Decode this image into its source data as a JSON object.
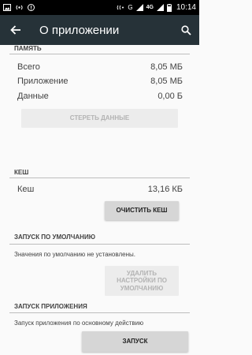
{
  "status_bar": {
    "time": "10:14",
    "network": "4G"
  },
  "app_bar": {
    "title": "О приложении"
  },
  "memory": {
    "header": "ПАМЯТЬ",
    "rows": [
      {
        "label": "Всего",
        "value": "8,05 МБ"
      },
      {
        "label": "Приложение",
        "value": "8,05 МБ"
      },
      {
        "label": "Данные",
        "value": "0,00 Б"
      }
    ],
    "clear_data_label": "СТЕРЕТЬ ДАННЫЕ"
  },
  "cache": {
    "header": "КЕШ",
    "label": "Кеш",
    "value": "13,16 КБ",
    "clear_cache_label": "ОЧИСТИТЬ КЕШ"
  },
  "defaults": {
    "header": "ЗАПУСК ПО УМОЛЧАНИЮ",
    "note": "Значения по умолчанию не установлены.",
    "remove_defaults_label": "УДАЛИТЬ\nНАСТРОЙКИ ПО\nУМОЛЧАНИЮ"
  },
  "launch": {
    "header": "ЗАПУСК ПРИЛОЖЕНИЯ",
    "note": "Запуск приложения по основному действию",
    "launch_label": "ЗАПУСК"
  }
}
